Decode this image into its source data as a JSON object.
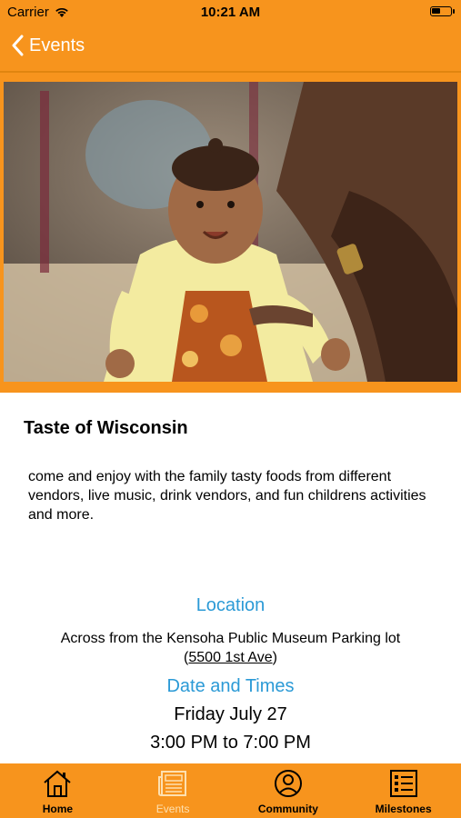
{
  "status_bar": {
    "carrier": "Carrier",
    "time": "10:21 AM"
  },
  "nav": {
    "back_label": "Events"
  },
  "event": {
    "title": "Taste of Wisconsin",
    "description": "come and enjoy with the family tasty foods from different vendors, live music, drink vendors, and fun childrens activities and more.",
    "location_heading": "Location",
    "location_text": "Across from the Kensoha Public Museum Parking lot",
    "address_open": "(",
    "address": "5500 1st Ave",
    "address_close": ")",
    "dates_heading": "Date and Times",
    "date": "Friday July 27",
    "times": "3:00 PM to 7:00 PM"
  },
  "tabs": [
    {
      "label": "Home",
      "icon": "house-icon"
    },
    {
      "label": "Events",
      "icon": "newspaper-icon"
    },
    {
      "label": "Community",
      "icon": "person-icon"
    },
    {
      "label": "Milestones",
      "icon": "checklist-icon"
    }
  ],
  "colors": {
    "brand_orange": "#f7941d",
    "link_blue": "#2b9ad6",
    "active_tab": "#fde0b0"
  }
}
